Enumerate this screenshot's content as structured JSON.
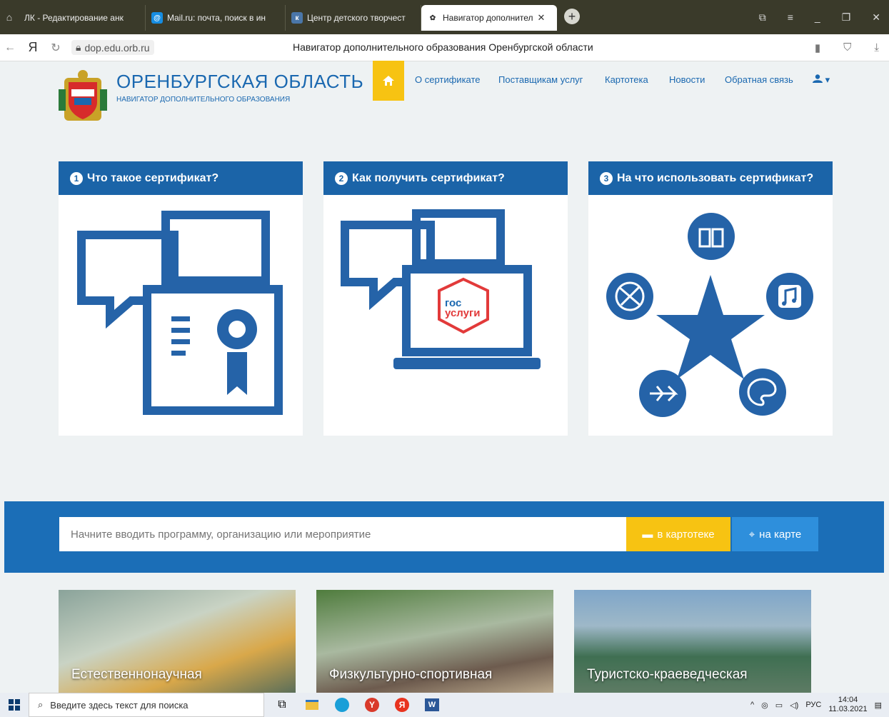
{
  "browser": {
    "tabs": [
      {
        "label": "ЛК - Редактирование анк",
        "icon": "home-icon"
      },
      {
        "label": "Mail.ru: почта, поиск в ин",
        "icon": "mailru-icon",
        "color": "#168de2"
      },
      {
        "label": "Центр детского творчест",
        "icon": "vk-icon",
        "color": "#4a76a8"
      },
      {
        "label": "Навигатор дополнител",
        "icon": "navigator-icon",
        "active": true
      }
    ],
    "url": "dop.edu.orb.ru",
    "page_title": "Навигатор дополнительного образования Оренбургской области"
  },
  "site": {
    "title": "ОРЕНБУРГСКАЯ ОБЛАСТЬ",
    "subtitle": "НАВИГАТОР ДОПОЛНИТЕЛЬНОГО ОБРАЗОВАНИЯ",
    "nav": [
      "О сертификате",
      "Поставщикам услуг",
      "Картотека",
      "Новости",
      "Обратная связь"
    ],
    "accent": "#1b64a8",
    "yellow": "#f7c312"
  },
  "cards": [
    {
      "num": "1",
      "title": "Что такое сертификат?"
    },
    {
      "num": "2",
      "title": "Как получить сертификат?",
      "logo_line1": "гос",
      "logo_line2": "услуги"
    },
    {
      "num": "3",
      "title": "На что использовать сертификат?"
    }
  ],
  "search": {
    "placeholder": "Начните вводить программу, организацию или мероприятие",
    "catalog_label": "в картотеке",
    "map_label": "на карте"
  },
  "categories": [
    "Естественнонаучная",
    "Физкультурно-спортивная",
    "Туристско-краеведческая"
  ],
  "taskbar": {
    "search_placeholder": "Введите здесь текст для поиска",
    "lang": "РУС",
    "time": "14:04",
    "date": "11.03.2021"
  }
}
